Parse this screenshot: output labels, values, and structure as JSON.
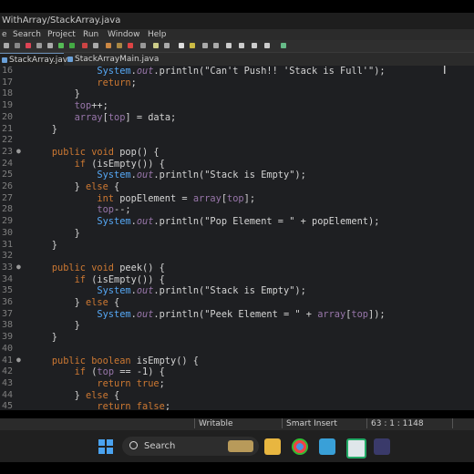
{
  "window": {
    "title": "WithArray/StackArray.java"
  },
  "menu": [
    "e",
    "Search",
    "Project",
    "Run",
    "Window",
    "Help"
  ],
  "tabs": [
    {
      "label": "StackArray.java",
      "active": true
    },
    {
      "label": "StackArrayMain.java",
      "active": false
    }
  ],
  "editor": {
    "line_numbers": [
      "16",
      "17",
      "18",
      "19",
      "20",
      "21",
      "22",
      "23",
      "24",
      "25",
      "26",
      "27",
      "28",
      "29",
      "30",
      "31",
      "32",
      "33",
      "34",
      "35",
      "36",
      "37",
      "38",
      "39",
      "40",
      "41",
      "42",
      "43",
      "44",
      "45"
    ],
    "fold_markers": [
      "23",
      "33",
      "41"
    ]
  },
  "status": {
    "writable": "Writable",
    "insert_mode": "Smart Insert",
    "position": "63 : 1 : 1148"
  },
  "taskbar": {
    "search_placeholder": "Search",
    "apps": [
      "file-explorer",
      "chrome",
      "notepad",
      "media-app",
      "eclipse"
    ]
  },
  "colors": {
    "keyword": "#cc7832",
    "class_ref": "#56a8f5",
    "static_field": "#9876aa",
    "background": "#1e1f22"
  }
}
